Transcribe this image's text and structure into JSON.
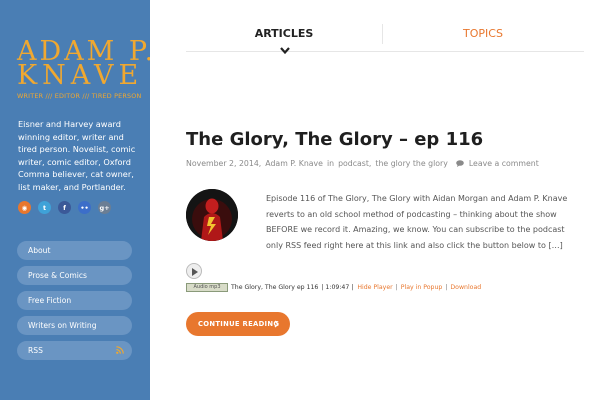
{
  "sidebar": {
    "logo_line1": "ADAM P.",
    "logo_line2": "KNAVE",
    "tagline": "WRITER /// EDITOR /// TIRED PERSON",
    "bio": "Eisner and Harvey award winning editor, writer and tired person. Novelist, comic writer, comic editor, Oxford Comma believer, cat owner, list maker, and Portlander.",
    "social": [
      {
        "icon": "rss-icon",
        "glyph": "◉"
      },
      {
        "icon": "twitter-icon",
        "glyph": "t"
      },
      {
        "icon": "facebook-icon",
        "glyph": "f"
      },
      {
        "icon": "flickr-icon",
        "glyph": "••"
      },
      {
        "icon": "google-plus-icon",
        "glyph": "g+"
      }
    ],
    "nav": [
      {
        "label": "About"
      },
      {
        "label": "Prose & Comics"
      },
      {
        "label": "Free Fiction"
      },
      {
        "label": "Writers on Writing"
      },
      {
        "label": "RSS"
      }
    ]
  },
  "topnav": {
    "articles": "ARTICLES",
    "topics": "TOPICS"
  },
  "post": {
    "title": "The Glory, The Glory – ep 116",
    "date": "November 2, 2014,",
    "author": "Adam P. Knave",
    "in_word": "in",
    "category1": "podcast,",
    "category2": "the glory the glory",
    "comment_label": "Leave a comment",
    "excerpt": "Episode 116 of The Glory, The Glory with Aidan Morgan and Adam P. Knave reverts to an old school method of podcasting – thinking about the show BEFORE we record it. Amazing, we know. You can subscribe to the podcast only RSS feed right here at this link and also click the button below to […]",
    "podcast": {
      "badge": "Audio mp3",
      "track": "The Glory, The Glory ep 116",
      "duration": "| 1:09:47 |",
      "hide_player": "Hide Player",
      "play_popup": "Play in Popup",
      "download": "Download"
    },
    "cta_label": "CONTINUE READING"
  },
  "colors": {
    "sidebar_bg": "#4a7eb4",
    "accent": "#e8772e",
    "logo": "#f0a830"
  }
}
